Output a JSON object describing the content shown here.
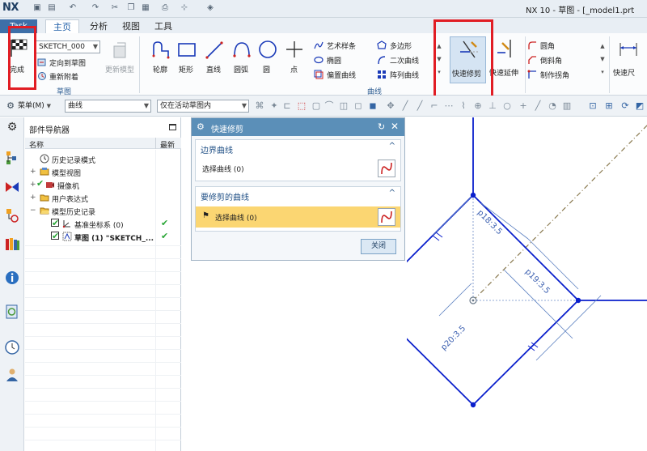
{
  "window": {
    "app_logo": "NX",
    "title": "NX 10 - 草图 - [_model1.prt"
  },
  "tabs": [
    {
      "label": "Task"
    },
    {
      "label": "主页"
    },
    {
      "label": "分析"
    },
    {
      "label": "视图"
    },
    {
      "label": "工具"
    }
  ],
  "ribbon": {
    "finish_label": "完成",
    "sketch_combo_value": "SKETCH_000",
    "orient_to_sketch": "定向到草图",
    "reattach": "重新附着",
    "update_model": "更新模型",
    "sketch_group_label": "草图",
    "curve_tools": [
      {
        "label": "轮廓",
        "icon": "profile-icon"
      },
      {
        "label": "矩形",
        "icon": "rectangle-icon"
      },
      {
        "label": "直线",
        "icon": "line-icon"
      },
      {
        "label": "圆弧",
        "icon": "arc-icon"
      },
      {
        "label": "圆",
        "icon": "circle-icon"
      },
      {
        "label": "点",
        "icon": "point-icon"
      }
    ],
    "curve_small_col1": [
      "艺术样条",
      "椭圆",
      "偏置曲线"
    ],
    "curve_small_col2": [
      "多边形",
      "二次曲线",
      "阵列曲线"
    ],
    "curve_group_label": "曲线",
    "quick_trim": "快速修剪",
    "quick_extend": "快速延伸",
    "edit_small": [
      "圆角",
      "倒斜角",
      "制作拐角"
    ],
    "quick_dim_partial": "快速尺"
  },
  "selbar": {
    "menu_label": "菜单(M)",
    "filter_value": "曲线",
    "scope_value": "仅在活动草图内"
  },
  "navigator": {
    "title": "部件导航器",
    "col_name": "名称",
    "col_latest": "最新",
    "items": [
      {
        "label": "历史记录模式",
        "icon": "clock-icon",
        "indent": 0,
        "expander": ""
      },
      {
        "label": "模型视图",
        "icon": "model-views-icon",
        "indent": 0,
        "expander": "+"
      },
      {
        "label": "摄像机",
        "icon": "camera-icon",
        "indent": 0,
        "expander": "+"
      },
      {
        "label": "用户表达式",
        "icon": "folder-icon",
        "indent": 0,
        "expander": "+"
      },
      {
        "label": "模型历史记录",
        "icon": "folder-icon",
        "indent": 0,
        "expander": "−"
      },
      {
        "label": "基准坐标系 (0)",
        "icon": "datum-csys-icon",
        "indent": 1,
        "expander": "",
        "latest": "✔"
      },
      {
        "label": "草图 (1) \"SKETCH_...",
        "icon": "sketch-icon",
        "indent": 1,
        "expander": "",
        "latest": "✔"
      }
    ]
  },
  "dialog": {
    "title": "快速修剪",
    "boundary_section": "边界曲线",
    "boundary_select": "选择曲线 (0)",
    "trim_section": "要修剪的曲线",
    "trim_select": "选择曲线 (0)",
    "close_label": "关闭"
  },
  "sketch": {
    "dims": [
      "p18:3.5",
      "p19:3.5",
      "p20:3.5"
    ]
  },
  "colors": {
    "sketch_blue": "#0a1fcc",
    "highlight_red": "#e11d24",
    "dialog_title": "#5b8fb8",
    "selected_row": "#fbd672"
  }
}
